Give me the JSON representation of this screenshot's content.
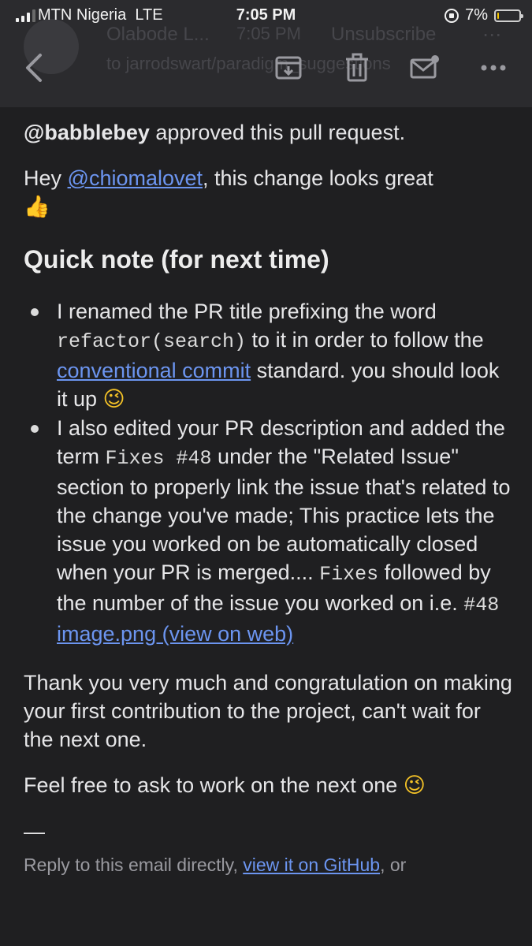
{
  "status_bar": {
    "carrier": "MTN Nigeria",
    "network": "LTE",
    "time": "7:05 PM",
    "battery_percent": "7%",
    "battery_level": 0.07,
    "signal_bars_active": 3,
    "signal_bars_total": 4
  },
  "header_ghost": {
    "sender": "Olabode L...",
    "time": "7:05 PM",
    "unsubscribe": "Unsubscribe",
    "to": "to jarrodswart/paradigm_suggestions"
  },
  "toolbar": {
    "back_icon": "chevron-left-icon",
    "archive_icon": "archive-icon",
    "trash_icon": "trash-icon",
    "mail_icon": "mail-unread-icon",
    "more_icon": "more-horizontal-icon"
  },
  "email": {
    "approval": {
      "user": "@babblebey",
      "text": " approved this pull request."
    },
    "greeting": {
      "prefix": "Hey ",
      "mention": "@chiomalovet",
      "suffix": ", this change looks great ",
      "emoji": "👍"
    },
    "heading": "Quick note (for next time)",
    "bullet1": {
      "t1": "I renamed the PR title prefixing the word ",
      "code1": "refactor(search)",
      "t2": " to it in order to follow the ",
      "link": "conventional commit",
      "t3": " standard. you should look it up ",
      "emoji": "😉"
    },
    "bullet2": {
      "t1": "I also edited your PR description and added the term ",
      "code1": "Fixes #48",
      "t2": " under the \"Related Issue\" section to properly link the issue that's related to the change you've made; This practice lets the issue you worked on be automatically closed when your PR is merged.... ",
      "code2": "Fixes",
      "t3": " followed by the number of the issue you worked on i.e. ",
      "code3": "#48",
      "link": "image.png (view on web)"
    },
    "thanks": "Thank you very much and congratulation on making your first contribution to the project, can't wait for the next one.",
    "free": {
      "text": "Feel free to ask to work on the next one ",
      "emoji": "😉"
    },
    "separator": "—",
    "footer": {
      "prefix": "Reply to this email directly, ",
      "link": "view it on GitHub",
      "suffix": ", or"
    }
  }
}
